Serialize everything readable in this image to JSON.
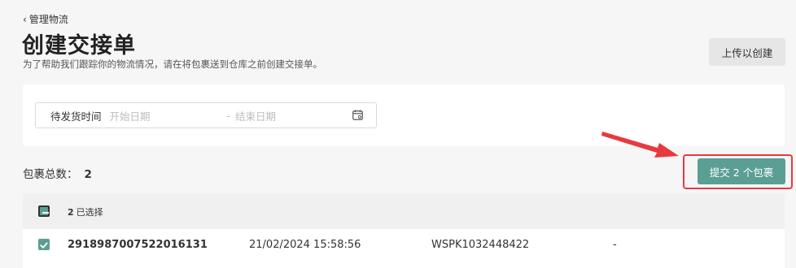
{
  "nav": {
    "back_label": "管理物流"
  },
  "header": {
    "title": "创建交接单",
    "subtitle": "为了帮助我们跟踪你的物流情况，请在将包裹送到仓库之前创建交接单。",
    "upload_button": "上传以创建"
  },
  "filter": {
    "label": "待发货时间",
    "start_placeholder": "开始日期",
    "separator": "-",
    "end_placeholder": "结束日期"
  },
  "summary": {
    "label": "包裹总数：",
    "count": "2",
    "submit_button": "提交 2 个包裹"
  },
  "table": {
    "selected_count": "2",
    "selected_label": "已选择",
    "rows": [
      {
        "tracking": "2918987007522016131",
        "datetime": "21/02/2024 15:58:56",
        "code": "WSPK1032448422",
        "extra": "-"
      }
    ]
  },
  "colors": {
    "accent": "#5b9e94",
    "highlight": "#e8393f"
  }
}
